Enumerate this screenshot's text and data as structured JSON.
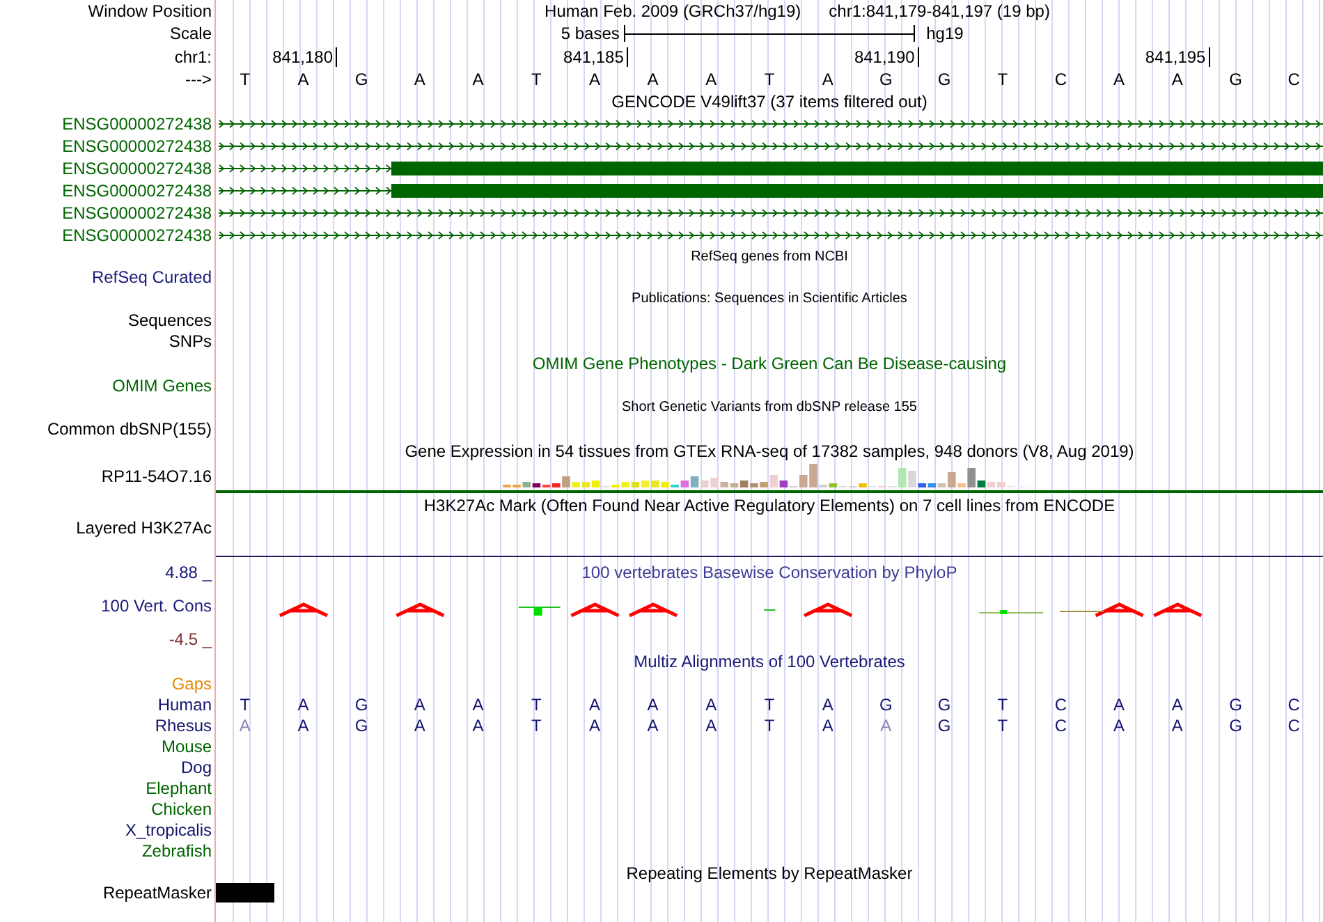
{
  "position": {
    "label": "Window Position",
    "assembly": "Human Feb. 2009 (GRCh37/hg19)",
    "range": "chr1:841,179-841,197 (19 bp)"
  },
  "scale": {
    "label": "Scale",
    "span": "5 bases",
    "assembly": "hg19"
  },
  "ruler": {
    "label": "chr1:",
    "ticks": [
      "841,180",
      "841,185",
      "841,190",
      "841,195"
    ]
  },
  "sequence": {
    "label": "--->",
    "bases": [
      "T",
      "A",
      "G",
      "A",
      "A",
      "T",
      "A",
      "A",
      "A",
      "T",
      "A",
      "G",
      "G",
      "T",
      "C",
      "A",
      "A",
      "G",
      "C"
    ]
  },
  "gencode": {
    "title": "GENCODE V49lift37 (37 items filtered out)",
    "genes": [
      {
        "name": "ENSG00000272438",
        "coding": false
      },
      {
        "name": "ENSG00000272438",
        "coding": false
      },
      {
        "name": "ENSG00000272438",
        "coding": true
      },
      {
        "name": "ENSG00000272438",
        "coding": true
      },
      {
        "name": "ENSG00000272438",
        "coding": false
      },
      {
        "name": "ENSG00000272438",
        "coding": false
      }
    ]
  },
  "refseq": {
    "title": "RefSeq genes from NCBI",
    "label": "RefSeq Curated"
  },
  "publications": {
    "title": "Publications: Sequences in Scientific Articles",
    "labels": [
      "Sequences",
      "SNPs"
    ]
  },
  "omim": {
    "title": "OMIM Gene Phenotypes - Dark Green Can Be Disease-causing",
    "label": "OMIM Genes"
  },
  "dbsnp": {
    "title": "Short Genetic Variants from dbSNP release 155",
    "label": "Common dbSNP(155)"
  },
  "gtex": {
    "title": "Gene Expression in 54 tissues from GTEx RNA-seq of 17382 samples, 948 donors (V8, Aug 2019)",
    "label": "RP11-54O7.16"
  },
  "h3k27ac": {
    "title": "H3K27Ac Mark (Often Found Near Active Regulatory Elements) on 7 cell lines from ENCODE",
    "label": "Layered H3K27Ac"
  },
  "phylop": {
    "title": "100 vertebrates Basewise Conservation by PhyloP",
    "label": "100 Vert. Cons",
    "max": "4.88 _",
    "min": "-4.5 _"
  },
  "multiz": {
    "title": "Multiz Alignments of 100 Vertebrates",
    "species": [
      {
        "name": "Gaps",
        "color": "#e68a00"
      },
      {
        "name": "Human",
        "color": "#141470",
        "bases": [
          {
            "base": "T",
            "faded": false
          },
          {
            "base": "A",
            "faded": false
          },
          {
            "base": "G",
            "faded": false
          },
          {
            "base": "A",
            "faded": false
          },
          {
            "base": "A",
            "faded": false
          },
          {
            "base": "T",
            "faded": false
          },
          {
            "base": "A",
            "faded": false
          },
          {
            "base": "A",
            "faded": false
          },
          {
            "base": "A",
            "faded": false
          },
          {
            "base": "T",
            "faded": false
          },
          {
            "base": "A",
            "faded": false
          },
          {
            "base": "G",
            "faded": false
          },
          {
            "base": "G",
            "faded": false
          },
          {
            "base": "T",
            "faded": false
          },
          {
            "base": "C",
            "faded": false
          },
          {
            "base": "A",
            "faded": false
          },
          {
            "base": "A",
            "faded": false
          },
          {
            "base": "G",
            "faded": false
          },
          {
            "base": "C",
            "faded": false
          }
        ]
      },
      {
        "name": "Rhesus",
        "color": "#141470",
        "bases": [
          {
            "base": "A",
            "faded": true
          },
          {
            "base": "A",
            "faded": false
          },
          {
            "base": "G",
            "faded": false
          },
          {
            "base": "A",
            "faded": false
          },
          {
            "base": "A",
            "faded": false
          },
          {
            "base": "T",
            "faded": false
          },
          {
            "base": "A",
            "faded": false
          },
          {
            "base": "A",
            "faded": false
          },
          {
            "base": "A",
            "faded": false
          },
          {
            "base": "T",
            "faded": false
          },
          {
            "base": "A",
            "faded": false
          },
          {
            "base": "A",
            "faded": true
          },
          {
            "base": "G",
            "faded": false
          },
          {
            "base": "T",
            "faded": false
          },
          {
            "base": "C",
            "faded": false
          },
          {
            "base": "A",
            "faded": false
          },
          {
            "base": "A",
            "faded": false
          },
          {
            "base": "G",
            "faded": false
          },
          {
            "base": "C",
            "faded": false
          }
        ]
      },
      {
        "name": "Mouse",
        "color": "#006400"
      },
      {
        "name": "Dog",
        "color": "#141470"
      },
      {
        "name": "Elephant",
        "color": "#006400"
      },
      {
        "name": "Chicken",
        "color": "#006400"
      },
      {
        "name": "X_tropicalis",
        "color": "#141470"
      },
      {
        "name": "Zebrafish",
        "color": "#006400"
      }
    ]
  },
  "repeatmasker": {
    "title": "Repeating Elements by RepeatMasker",
    "label": "RepeatMasker"
  }
}
